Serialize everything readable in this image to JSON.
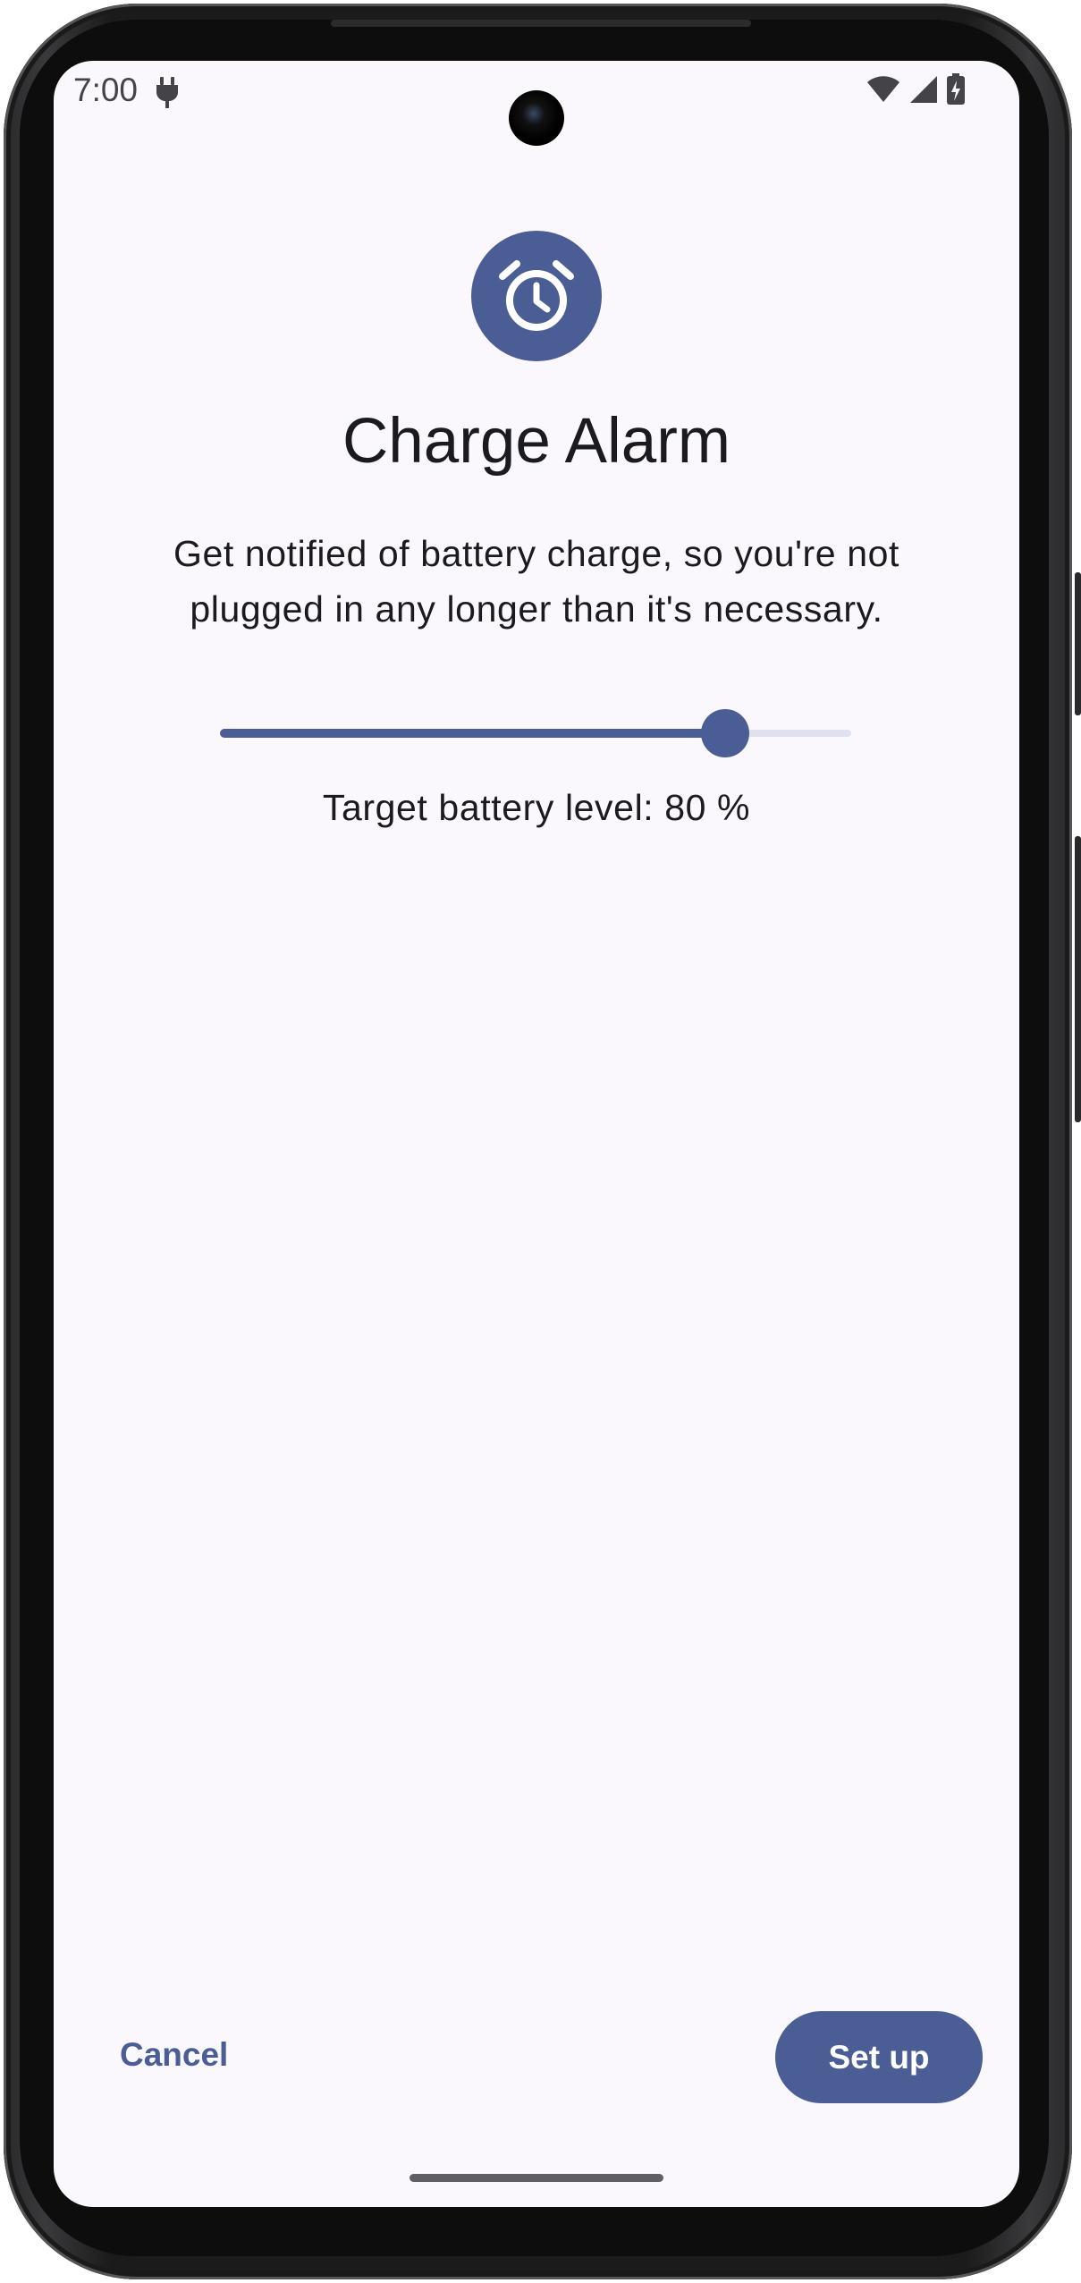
{
  "status_bar": {
    "time": "7:00",
    "icons": [
      "plug-icon",
      "wifi-icon",
      "cellular-signal-icon",
      "battery-charging-icon"
    ]
  },
  "app": {
    "icon": "alarm-clock-icon",
    "title": "Charge Alarm",
    "description": "Get notified of battery charge, so you're not plugged in any longer than it's necessary."
  },
  "slider": {
    "value_fraction": 0.8,
    "label": "Target battery level: 80 %"
  },
  "actions": {
    "cancel_label": "Cancel",
    "setup_label": "Set up"
  },
  "colors": {
    "accent": "#4a5d94",
    "background": "#faf8fc",
    "text": "#1b1b1f",
    "track_inactive": "#e0e1ec"
  }
}
